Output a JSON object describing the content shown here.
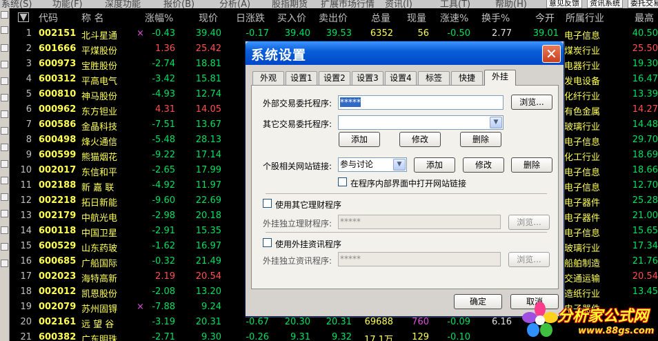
{
  "menubar": {
    "items": [
      "系统(S)",
      "功能(F)",
      "深度功能",
      "报价(B)",
      "分析(A)",
      "股指期货",
      "扩展市场行情",
      "资讯(I)",
      "工具(T)",
      "帮助(H)"
    ],
    "buttons": [
      "意见反馈",
      "资讯系统",
      "委托交易"
    ]
  },
  "table": {
    "headers": {
      "code": "代码",
      "name": "称 名",
      "chg": "涨幅%",
      "price": "现价",
      "rise": "日涨跌",
      "buy": "买入价",
      "sell": "卖出价",
      "vol": "总量",
      "now": "现量",
      "spd": "涨速%",
      "turn": "换手%",
      "open": "今开",
      "ind": "所属行业",
      "high": "最高"
    },
    "rows": [
      {
        "idx": "1",
        "code": "002151",
        "name": "北斗星通",
        "mark": "×",
        "chg": "-0.43",
        "price": "39.40",
        "rise": "-0.17",
        "buy": "39.40",
        "sell": "39.53",
        "vol": "6352",
        "now": "56",
        "spd": "-0.50",
        "turn": "2.77",
        "open": "39.01",
        "ind": "电子信息",
        "high": "40.50"
      },
      {
        "idx": "2",
        "code": "601666",
        "name": "平煤股份",
        "mark": "",
        "chg": "1.36",
        "price": "25.42",
        "rise": "",
        "buy": "",
        "sell": "",
        "vol": "",
        "now": "",
        "spd": "",
        "turn": "",
        "open": "",
        "ind": "煤炭行业",
        "high": "25.50"
      },
      {
        "idx": "3",
        "code": "600973",
        "name": "宝胜股份",
        "mark": "",
        "chg": "-2.74",
        "price": "18.81",
        "rise": "",
        "buy": "",
        "sell": "",
        "vol": "",
        "now": "",
        "spd": "",
        "turn": "",
        "open": "",
        "ind": "电器行业",
        "high": "19.30"
      },
      {
        "idx": "4",
        "code": "600312",
        "name": "平高电气",
        "mark": "",
        "chg": "-3.42",
        "price": "15.81",
        "rise": "",
        "buy": "",
        "sell": "",
        "vol": "",
        "now": "",
        "spd": "",
        "turn": "",
        "open": "",
        "ind": "发电设备",
        "high": "16.47"
      },
      {
        "idx": "5",
        "code": "600810",
        "name": "神马股份",
        "mark": "",
        "chg": "-4.93",
        "price": "12.74",
        "rise": "",
        "buy": "",
        "sell": "",
        "vol": "",
        "now": "",
        "spd": "",
        "turn": "",
        "open": "",
        "ind": "化纤行业",
        "high": "13.39"
      },
      {
        "idx": "6",
        "code": "000962",
        "name": "东方钽业",
        "mark": "",
        "chg": "4.31",
        "price": "14.05",
        "rise": "",
        "buy": "",
        "sell": "",
        "vol": "",
        "now": "",
        "spd": "",
        "turn": "",
        "open": "",
        "ind": "有色金属",
        "high": "14.27"
      },
      {
        "idx": "7",
        "code": "600586",
        "name": "金晶科技",
        "mark": "",
        "chg": "-7.51",
        "price": "13.67",
        "rise": "",
        "buy": "",
        "sell": "",
        "vol": "",
        "now": "",
        "spd": "",
        "turn": "",
        "open": "",
        "ind": "玻璃行业",
        "high": "14.48"
      },
      {
        "idx": "8",
        "code": "600498",
        "name": "烽火通信",
        "mark": "",
        "chg": "-5.48",
        "price": "28.13",
        "rise": "",
        "buy": "",
        "sell": "",
        "vol": "",
        "now": "",
        "spd": "",
        "turn": "",
        "open": "",
        "ind": "电子信息",
        "high": "29.70"
      },
      {
        "idx": "9",
        "code": "600599",
        "name": "熊猫烟花",
        "mark": "",
        "chg": "-9.22",
        "price": "17.14",
        "rise": "",
        "buy": "",
        "sell": "",
        "vol": "",
        "now": "",
        "spd": "",
        "turn": "",
        "open": "",
        "ind": "化工行业",
        "high": "18.69"
      },
      {
        "idx": "10",
        "code": "002017",
        "name": "东信和平",
        "mark": "",
        "chg": "-2.65",
        "price": "17.99",
        "rise": "",
        "buy": "",
        "sell": "",
        "vol": "",
        "now": "",
        "spd": "",
        "turn": "",
        "open": "",
        "ind": "电子信息",
        "high": "18.66"
      },
      {
        "idx": "11",
        "code": "002188",
        "name": "新 嘉 联",
        "mark": "",
        "chg": "-4.92",
        "price": "11.97",
        "rise": "",
        "buy": "",
        "sell": "",
        "vol": "",
        "now": "",
        "spd": "",
        "turn": "",
        "open": "",
        "ind": "电子信息",
        "high": "12.70"
      },
      {
        "idx": "12",
        "code": "002218",
        "name": "拓日新能",
        "mark": "",
        "chg": "-9.60",
        "price": "22.69",
        "rise": "",
        "buy": "",
        "sell": "",
        "vol": "",
        "now": "",
        "spd": "",
        "turn": "",
        "open": "",
        "ind": "电子器件",
        "high": "25.28"
      },
      {
        "idx": "13",
        "code": "002179",
        "name": "中航光电",
        "mark": "",
        "chg": "-2.98",
        "price": "20.18",
        "rise": "",
        "buy": "",
        "sell": "",
        "vol": "",
        "now": "",
        "spd": "",
        "turn": "",
        "open": "",
        "ind": "电子器件",
        "high": "21.00"
      },
      {
        "idx": "14",
        "code": "600118",
        "name": "中国卫星",
        "mark": "",
        "chg": "-2.91",
        "price": "15.35",
        "rise": "",
        "buy": "",
        "sell": "",
        "vol": "",
        "now": "",
        "spd": "",
        "turn": "",
        "open": "",
        "ind": "电子信息",
        "high": "15.65"
      },
      {
        "idx": "15",
        "code": "600529",
        "name": "山东药玻",
        "mark": "",
        "chg": "-1.62",
        "price": "16.97",
        "rise": "",
        "buy": "",
        "sell": "",
        "vol": "",
        "now": "",
        "spd": "",
        "turn": "",
        "open": "",
        "ind": "玻璃行业",
        "high": "17.34"
      },
      {
        "idx": "16",
        "code": "600685",
        "name": "广船国际",
        "mark": "",
        "chg": "-0.32",
        "price": "21.49",
        "rise": "",
        "buy": "",
        "sell": "",
        "vol": "",
        "now": "",
        "spd": "",
        "turn": "",
        "open": "",
        "ind": "船舶制造",
        "high": "21.76"
      },
      {
        "idx": "17",
        "code": "002023",
        "name": "海特高新",
        "mark": "",
        "chg": "2.19",
        "price": "20.54",
        "rise": "",
        "buy": "",
        "sell": "",
        "vol": "",
        "now": "",
        "spd": "",
        "turn": "",
        "open": "",
        "ind": "交通运输",
        "high": "20.54"
      },
      {
        "idx": "18",
        "code": "002012",
        "name": "凯恩股份",
        "mark": "",
        "chg": "-2.08",
        "price": "13.20",
        "rise": "",
        "buy": "",
        "sell": "",
        "vol": "",
        "now": "",
        "spd": "",
        "turn": "",
        "open": "",
        "ind": "造纸行业",
        "high": "13.45"
      },
      {
        "idx": "19",
        "code": "002079",
        "name": "苏州固锝",
        "mark": "×",
        "chg": "-7.88",
        "price": "9.24",
        "rise": "",
        "buy": "",
        "sell": "",
        "vol": "",
        "now": "",
        "spd": "",
        "turn": "",
        "open": "",
        "ind": "电子器件",
        "high": ""
      },
      {
        "idx": "20",
        "code": "002161",
        "name": "远 望 谷",
        "mark": "",
        "chg": "-3.19",
        "price": "20.31",
        "rise": "-0.67",
        "buy": "20.30",
        "sell": "20.31",
        "vol": "69688",
        "now": "760",
        "spd": "-0.09",
        "turn": "6.16",
        "open": "",
        "ind": "",
        "high": ""
      },
      {
        "idx": "21",
        "code": "600382",
        "name": "广东明珠",
        "mark": "",
        "chg": "-2.71",
        "price": "9.30",
        "rise": "-0.26",
        "buy": "9.31",
        "sell": "9.32",
        "vol": "17.1万",
        "now": "129",
        "spd": "-0.10",
        "turn": "",
        "open": "",
        "ind": "",
        "high": ""
      }
    ]
  },
  "dialog": {
    "title": "系统设置",
    "close_label": "✕",
    "tabs": [
      "外观",
      "设置1",
      "设置2",
      "设置3",
      "设置4",
      "标签",
      "快捷",
      "外挂"
    ],
    "active_tab": "外挂",
    "trade_label": "外部交易委托程序:",
    "trade_value": "*****",
    "browse_label": "浏览...",
    "other_label": "其它交易委托程序:",
    "other_value": "",
    "add_label": "添加",
    "edit_label": "修改",
    "delete_label": "删除",
    "link_label": "个股相关网站链接:",
    "link_value": "参与讨论",
    "inner_open_label": "在程序内部界面中打开网站链接",
    "use_finance_label": "使用其它理财程序",
    "finance_label": "外挂独立理财程序:",
    "finance_value": "*****",
    "use_news_label": "使用外挂资讯程序",
    "news_label": "外挂独立资讯程序:",
    "news_value": "*****",
    "ok_label": "确定",
    "cancel_label": "取消"
  },
  "logo": {
    "brand": "分析家公式网",
    "url": "www.88gs.com"
  },
  "colors": {
    "up": "#ff5050",
    "down": "#00e060",
    "code": "#ffff54",
    "dialog_title": "#0a5fd8"
  }
}
